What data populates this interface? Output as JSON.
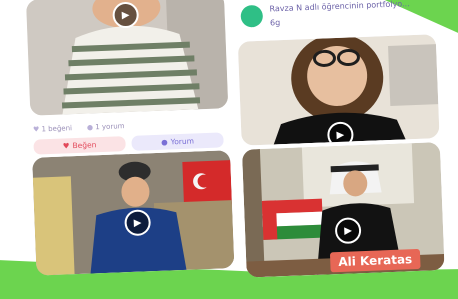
{
  "posts": {
    "left_top": {
      "likes": "1 beğeni",
      "comments": "1 yorum",
      "like_button": "Beğen",
      "comment_button": "Yorum"
    },
    "right_top": {
      "author_line": "Ravza N adlı öğrencinin portfolyo...",
      "class_line": "6g"
    },
    "right_bottom": {
      "name_tag": "Ali Keratas"
    }
  },
  "icons": {
    "play": "▶",
    "heart": "♥",
    "comment": "💬"
  },
  "colors": {
    "accent_green": "#6cd44f",
    "like_red": "#e2495a",
    "comment_purple": "#7a6fd6",
    "name_tag_bg": "#e76756"
  }
}
